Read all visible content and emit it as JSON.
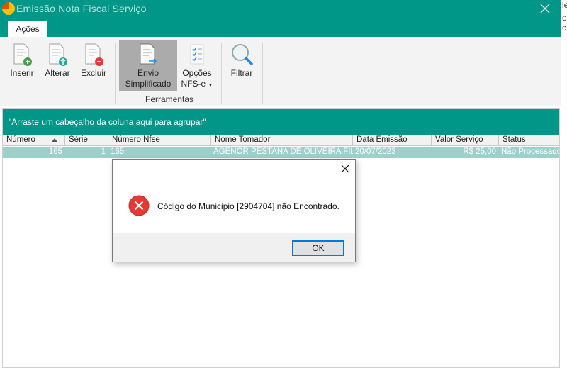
{
  "window": {
    "title": "Emissão Nota Fiscal Serviço"
  },
  "tabs": [
    {
      "label": "Ações",
      "active": true
    }
  ],
  "ribbon": {
    "buttons": {
      "inserir": "Inserir",
      "alterar": "Alterar",
      "excluir": "Excluir",
      "envio_line1": "Envio",
      "envio_line2": "Simplificado",
      "opcoes_line1": "Opções",
      "opcoes_line2": "NFS-e",
      "filtrar": "Filtrar"
    },
    "group_label": "Ferramentas"
  },
  "grid": {
    "group_hint": "\"Arraste um cabeçalho da coluna aqui para agrupar\"",
    "columns": [
      "Número",
      "Série",
      "Número Nfse",
      "Nome Tomador",
      "Data Emissão",
      "Valor Serviço",
      "Status"
    ],
    "rows": [
      {
        "numero": "165",
        "serie": "1",
        "numero_nfse": "165",
        "nome_tomador": "AGENOR PESTANA DE OLIVEIRA FILHO",
        "data_emissao": "20/07/2023",
        "valor_servico": "R$ 25,00",
        "status": "Não Processado"
      }
    ]
  },
  "side_strip": {
    "line1": "le",
    "line2": "e c"
  },
  "dialog": {
    "message": "Código do Municipio [2904704] não Encontrado.",
    "ok_label": "OK"
  },
  "colors": {
    "accent": "#009688",
    "selected_row": "#9ed0cb",
    "error": "#e53935"
  }
}
